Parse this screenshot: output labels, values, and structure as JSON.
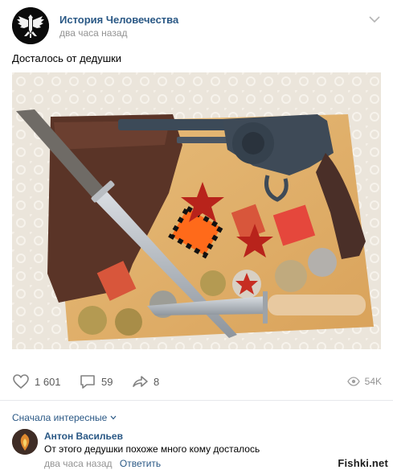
{
  "post": {
    "group_name": "История Человечества",
    "time": "два часа назад",
    "text": "Досталось от дедушки"
  },
  "actions": {
    "likes": "1 601",
    "comments": "59",
    "shares": "8",
    "views": "54K"
  },
  "comments_section": {
    "sort_label": "Сначала интересные",
    "comment": {
      "author": "Антон Васильев",
      "text": "От этого дедушки похоже много кому досталось",
      "time": "два часа назад",
      "reply_label": "Ответить"
    }
  },
  "watermark": "Fishki.net",
  "icons": {
    "avatar": "eagle-emblem-icon",
    "more": "chevron-down-icon",
    "like": "heart-icon",
    "comment": "comment-bubble-icon",
    "share": "share-arrow-icon",
    "views": "eye-icon"
  },
  "colors": {
    "link": "#2a5885",
    "muted": "#939393",
    "icon": "#828282"
  }
}
